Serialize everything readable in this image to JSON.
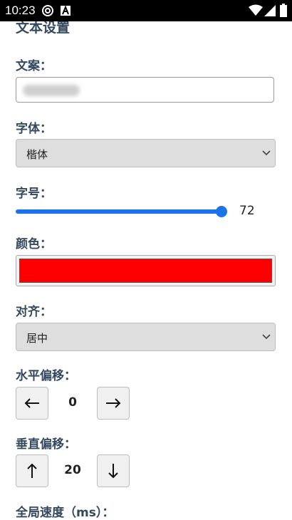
{
  "status_bar": {
    "time": "10:23",
    "icons": [
      "at-sign-icon",
      "app-a-icon",
      "wifi-icon",
      "signal-icon",
      "battery-icon"
    ]
  },
  "settings": {
    "title": "文本设置",
    "text_label": "文案：",
    "font_label": "字体：",
    "font_value": "楷体",
    "size_label": "字号：",
    "size_value": "72",
    "size_fraction": 0.995,
    "color_label": "颜色：",
    "color_value": "#ff0000",
    "align_label": "对齐：",
    "align_value": "居中",
    "h_offset_label": "水平偏移：",
    "h_offset_value": "0",
    "v_offset_label": "垂直偏移：",
    "v_offset_value": "20",
    "speed_label": "全局速度（ms）："
  },
  "colors": {
    "accent": "#1a73e8",
    "label": "#34495e",
    "selected_color": "#ff0000"
  }
}
